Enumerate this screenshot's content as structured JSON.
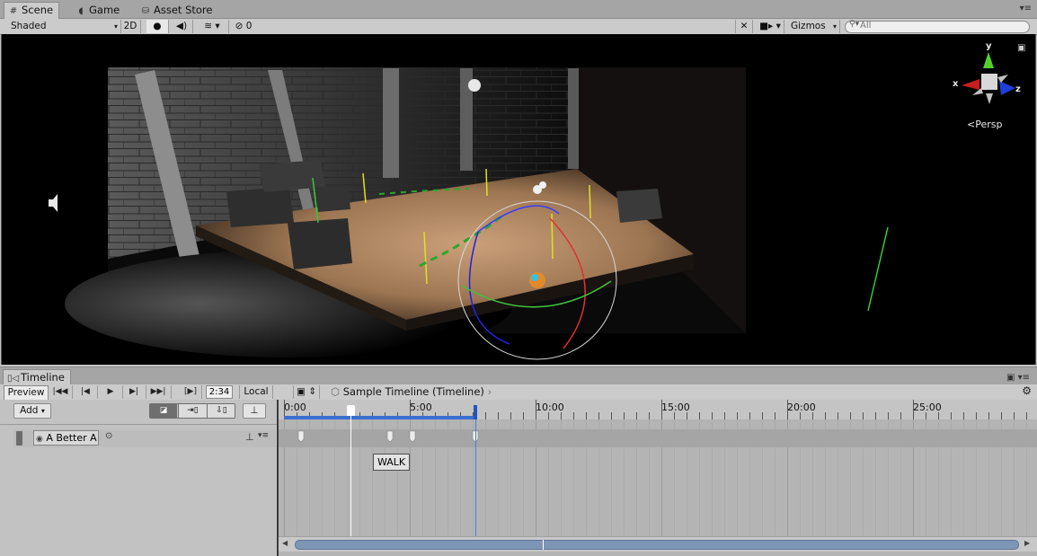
{
  "tabs": [
    {
      "label": "Scene",
      "icon": "grid-icon",
      "active": true
    },
    {
      "label": "Game",
      "icon": "pacman-icon",
      "active": false
    },
    {
      "label": "Asset Store",
      "icon": "store-icon",
      "active": false
    }
  ],
  "scene_toolbar": {
    "draw_mode": "Shaded",
    "mode_2d": "2D",
    "hidden_count": "0",
    "gizmos": "Gizmos",
    "search_placeholder": "All"
  },
  "scene": {
    "camera_label": "Persp",
    "axis_x": "x",
    "axis_y": "y",
    "axis_z": "z"
  },
  "timeline": {
    "tab_label": "Timeline",
    "preview_label": "Preview",
    "frame_value": "2:34",
    "space_label": "Local",
    "breadcrumb": "Sample Timeline (Timeline)",
    "add_label": "Add",
    "track_name": "A Better A",
    "clip_label": "WALK",
    "ruler": [
      {
        "label": "0:00"
      },
      {
        "label": "5:00"
      },
      {
        "label": "10:00"
      },
      {
        "label": "15:00"
      },
      {
        "label": "20:00"
      },
      {
        "label": "25:00"
      }
    ]
  }
}
